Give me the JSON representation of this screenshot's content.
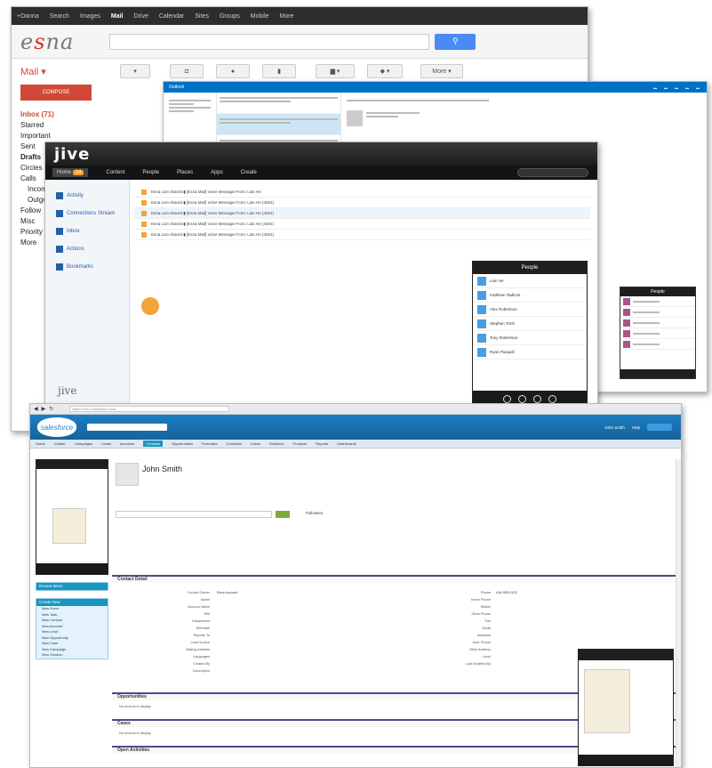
{
  "gmail": {
    "topbar": [
      "+Danna",
      "Search",
      "Images",
      "Mail",
      "Drive",
      "Calendar",
      "Sites",
      "Groups",
      "Mobile",
      "More"
    ],
    "logo_prefix": "e",
    "logo_accent": "s",
    "logo_suffix": "na",
    "mail_label": "Mail",
    "compose_label": "COMPOSE",
    "nav": [
      "Inbox (71)",
      "Starred",
      "Important",
      "Sent",
      "Drafts",
      "Circles",
      "Calls",
      "Incoming",
      "Outgoing",
      "Follow",
      "Misc",
      "Priority",
      "More"
    ],
    "toolbar": [
      "▾",
      "◘",
      "●",
      "▮",
      "▆ ▾",
      "◆ ▾",
      "More ▾"
    ]
  },
  "outlook": {
    "title": "Outlook",
    "people_title": "People"
  },
  "jive": {
    "logo": "jive",
    "nav": [
      "Home",
      "Content",
      "People",
      "Places",
      "Apps",
      "Create"
    ],
    "badge": "24",
    "side": [
      "Activity",
      "Connections Stream",
      "Inbox",
      "Actions",
      "Bookmarks"
    ],
    "footer": "jive",
    "rows": [
      "Esna Lion shared ▮ [Esna Mail] Voice Message From: Lian He",
      "Esna Lion shared ▮ [Esna Mail] Voice Message From: Lian He (4001)",
      "Esna Lion shared ▮ [Esna Mail] Voice Message From: Lian He (4001)",
      "Esna Lion shared ▮ [Esna Mail] Voice Message From: Lian He (4001)",
      "Esna Lion shared ▮ [Esna Mail] Voice Message From: Lian He (4001)"
    ],
    "people_title": "People",
    "people": [
      "Lian He",
      "Kathleen Tadlock",
      "Alex Robertson",
      "Stephen Trinh",
      "Tony Robertson",
      "Ryan Pasquill"
    ]
  },
  "salesforce": {
    "url": "https://na12.salesforce.com",
    "logo": "salesforce",
    "user_label": "John Smith",
    "help_label": "Help",
    "tabs": [
      "Home",
      "Chatter",
      "Campaigns",
      "Leads",
      "Accounts",
      "Contacts",
      "Opportunities",
      "Forecasts",
      "Contracts",
      "Cases",
      "Solutions",
      "Products",
      "Reports",
      "Dashboards"
    ],
    "active_tab": "Contacts",
    "contact_name": "John Smith",
    "followers_label": "Followers",
    "share_label": "Share",
    "sidebar_box1": "Recent Items",
    "sidebar_box2": "Create New",
    "sidebar_links": [
      "New Event",
      "New Task",
      "New Contact",
      "New Account",
      "New Lead",
      "New Opportunity",
      "New Case",
      "New Campaign",
      "New Solution"
    ],
    "sections": [
      "Contact Detail",
      "Opportunities",
      "Cases",
      "Open Activities"
    ],
    "detail_left": [
      "Contact Owner",
      "Name",
      "Account Name",
      "Title",
      "Department",
      "Birthdate",
      "Reports To",
      "Lead Source",
      "Mailing Address",
      "Languages",
      "Created By",
      "Description"
    ],
    "detail_right": [
      "Phone",
      "Home Phone",
      "Mobile",
      "Other Phone",
      "Fax",
      "Email",
      "Assistant",
      "Asst. Phone",
      "Other Address",
      "Level",
      "Last Modified By"
    ],
    "owner_value": "Esna Account",
    "phone_value": "416-555-0123",
    "no_records": "No records to display"
  }
}
